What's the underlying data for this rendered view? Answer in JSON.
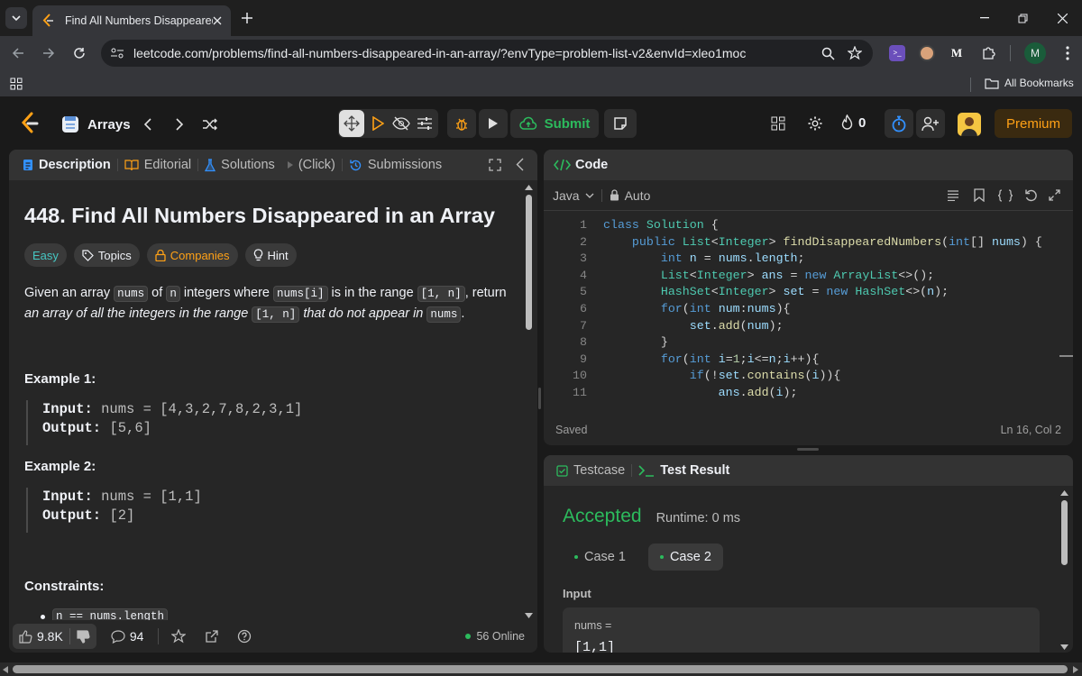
{
  "browser": {
    "tab_title": "Find All Numbers Disappeared",
    "url": "leetcode.com/problems/find-all-numbers-disappeared-in-an-array/?envType=problem-list-v2&envId=xleo1moc",
    "profile_initial": "M",
    "bookmarks_label": "All Bookmarks"
  },
  "header": {
    "list_name": "Arrays",
    "submit_label": "Submit",
    "streak_count": "0",
    "premium_label": "Premium"
  },
  "left_panel": {
    "tabs": {
      "description": "Description",
      "editorial": "Editorial",
      "solutions": "Solutions",
      "click": "(Click)",
      "submissions": "Submissions"
    },
    "title": "448. Find All Numbers Disappeared in an Array",
    "badges": {
      "difficulty": "Easy",
      "topics": "Topics",
      "companies": "Companies",
      "hint": "Hint"
    },
    "statement": {
      "p1": "Given an array ",
      "c1": "nums",
      "p2": " of ",
      "c2": "n",
      "p3": " integers where ",
      "c3": "nums[i]",
      "p4": " is in the range ",
      "c4": "[1, n]",
      "p5": ", return",
      "i1": "an array of all the integers in the range ",
      "c5": "[1, n]",
      "i2": " that do not appear in ",
      "c6": "nums",
      "p6": "."
    },
    "examples": [
      {
        "heading": "Example 1:",
        "input_label": "Input:",
        "input_value": "nums = [4,3,2,7,8,2,3,1]",
        "output_label": "Output:",
        "output_value": "[5,6]"
      },
      {
        "heading": "Example 2:",
        "input_label": "Input:",
        "input_value": "nums = [1,1]",
        "output_label": "Output:",
        "output_value": "[2]"
      }
    ],
    "constraints_heading": "Constraints:",
    "constraint_partial": "n == nums.length",
    "footer": {
      "likes": "9.8K",
      "comments": "94",
      "online": "56 Online"
    }
  },
  "code_panel": {
    "title": "Code",
    "language": "Java",
    "mode": "Auto",
    "status_saved": "Saved",
    "cursor_pos": "Ln 16, Col 2",
    "lines": [
      {
        "n": "1"
      },
      {
        "n": "2"
      },
      {
        "n": "3"
      },
      {
        "n": "4"
      },
      {
        "n": "5"
      },
      {
        "n": "6"
      },
      {
        "n": "7"
      },
      {
        "n": "8"
      },
      {
        "n": "9"
      },
      {
        "n": "10"
      },
      {
        "n": "11"
      }
    ]
  },
  "test_panel": {
    "tab_testcase": "Testcase",
    "tab_result": "Test Result",
    "verdict": "Accepted",
    "runtime": "Runtime: 0 ms",
    "case1": "Case 1",
    "case2": "Case 2",
    "input_label": "Input",
    "var_name": "nums =",
    "var_value": "[1,1]"
  },
  "colors": {
    "accent_orange": "#ffa116",
    "accepted_green": "#2cbb5d",
    "easy_teal": "#46c6c2",
    "link_blue": "#3291ff"
  }
}
